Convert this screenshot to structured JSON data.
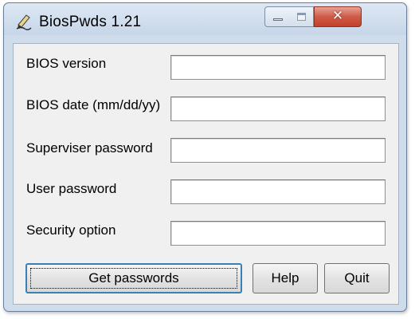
{
  "window": {
    "title": "BiosPwds 1.21",
    "app_icon": "pen-icon",
    "minimize_icon": "minimize-icon",
    "maximize_icon": "maximize-icon",
    "close_glyph": "✕"
  },
  "fields": [
    {
      "label": "BIOS version",
      "value": ""
    },
    {
      "label": "BIOS date (mm/dd/yy)",
      "value": ""
    },
    {
      "label": "Superviser password",
      "value": ""
    },
    {
      "label": "User password",
      "value": ""
    },
    {
      "label": "Security option",
      "value": ""
    }
  ],
  "buttons": {
    "get_passwords": "Get passwords",
    "help": "Help",
    "quit": "Quit"
  }
}
